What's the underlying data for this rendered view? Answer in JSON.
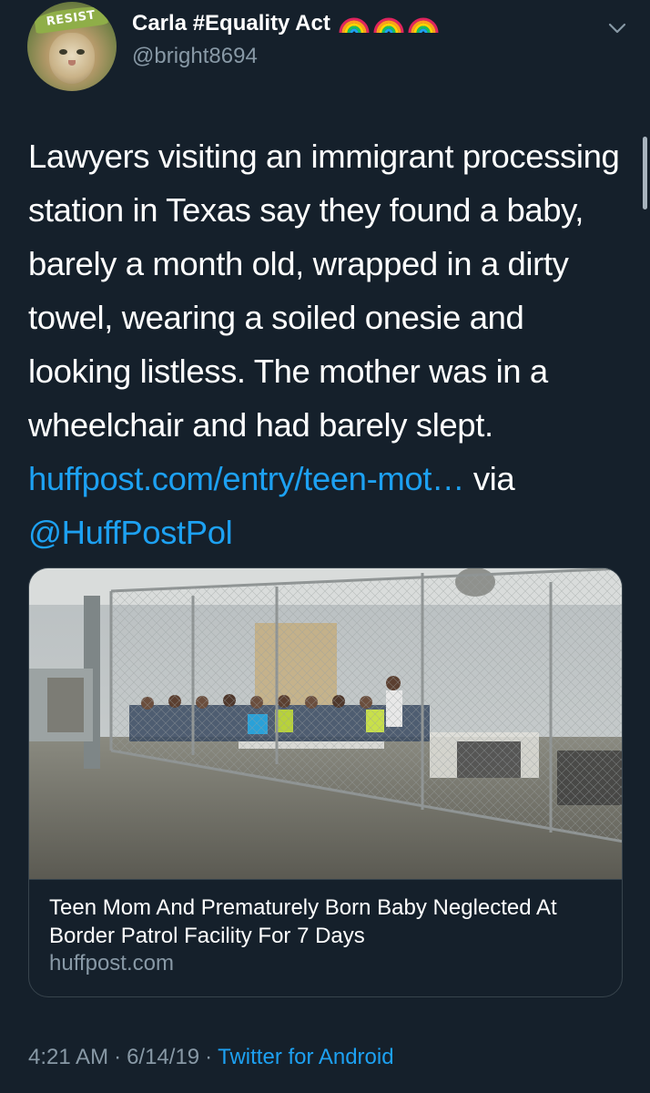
{
  "author": {
    "display_name": "Carla #Equality Act",
    "handle": "@bright8694",
    "avatar_badge_text": "RESIST",
    "name_emoji_count": 3
  },
  "tweet": {
    "text": "Lawyers visiting an immigrant processing station in Texas say they found a baby, barely a month old, wrapped in a dirty towel, wearing a soiled onesie and looking listless. The mother was in a wheelchair and had barely slept. ",
    "link_text": "huffpost.com/entry/teen-mot…",
    "via_text": " via ",
    "mention": "@HuffPostPol"
  },
  "card": {
    "title": "Teen Mom And Prematurely Born Baby Neglected At Border Patrol Facility For 7 Days",
    "domain": "huffpost.com"
  },
  "meta": {
    "time": "4:21 AM",
    "date": "6/14/19",
    "separator": "·",
    "source": "Twitter for Android"
  },
  "colors": {
    "background": "#15202b",
    "text_primary": "#ffffff",
    "text_secondary": "#8899a6",
    "link": "#1da1f2",
    "border": "#38444d"
  }
}
